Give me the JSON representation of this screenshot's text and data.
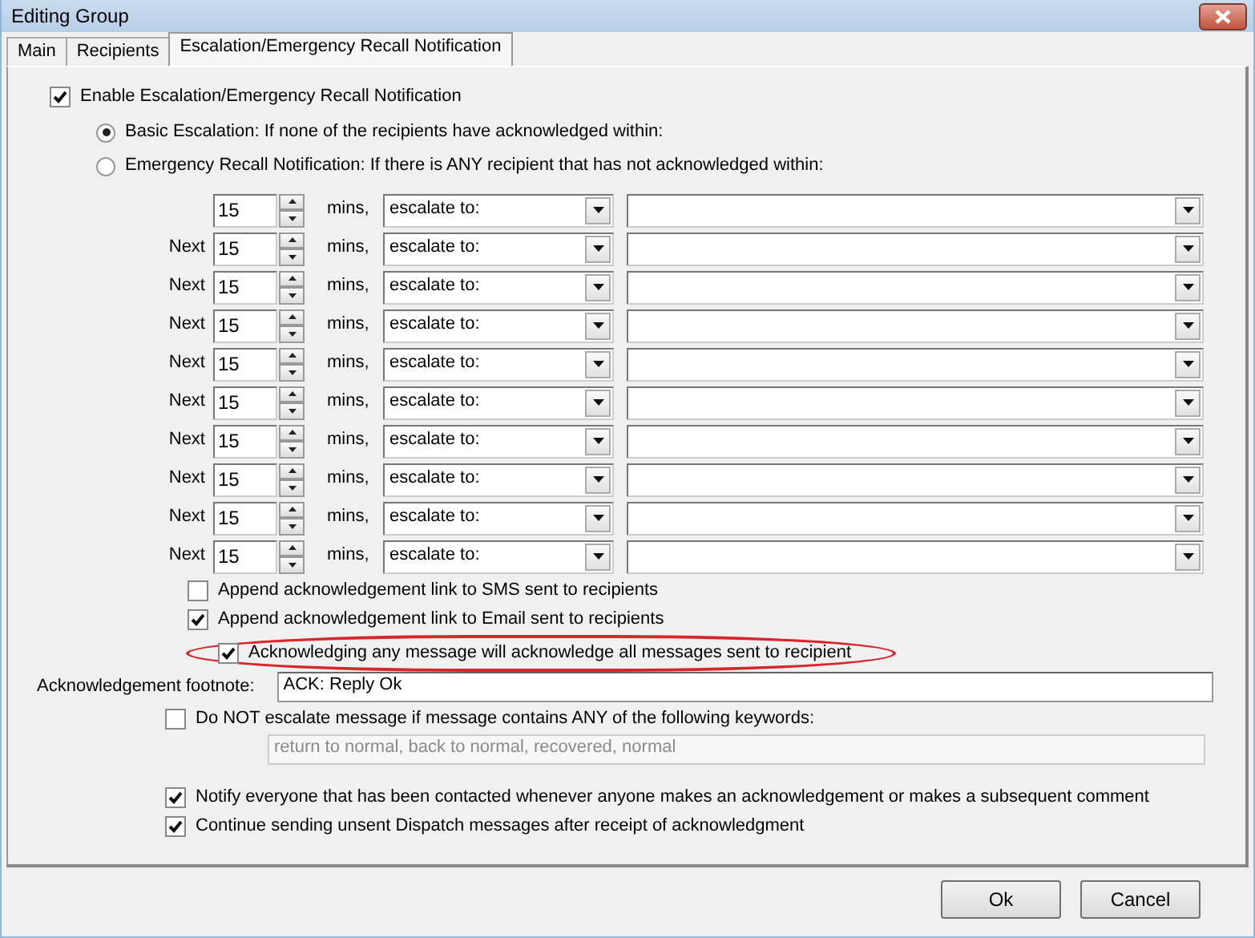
{
  "window": {
    "title": "Editing Group"
  },
  "tabs": [
    {
      "label": "Main",
      "selected": false
    },
    {
      "label": "Recipients",
      "selected": false
    },
    {
      "label": "Escalation/Emergency Recall Notification",
      "selected": true
    }
  ],
  "enable": {
    "label": "Enable Escalation/Emergency Recall Notification",
    "checked": true
  },
  "modes": [
    {
      "label": "Basic Escalation: If none of the recipients have acknowledged within:",
      "selected": true
    },
    {
      "label": "Emergency Recall Notification: If there is ANY recipient that has not acknowledged within:",
      "selected": false
    }
  ],
  "escalation_rows": [
    {
      "minutes": "15",
      "unit": "mins,",
      "action": "escalate to:"
    },
    {
      "prefix": "Next",
      "minutes": "15",
      "unit": "mins,",
      "action": "escalate to:"
    },
    {
      "prefix": "Next",
      "minutes": "15",
      "unit": "mins,",
      "action": "escalate to:"
    },
    {
      "prefix": "Next",
      "minutes": "15",
      "unit": "mins,",
      "action": "escalate to:"
    },
    {
      "prefix": "Next",
      "minutes": "15",
      "unit": "mins,",
      "action": "escalate to:"
    },
    {
      "prefix": "Next",
      "minutes": "15",
      "unit": "mins,",
      "action": "escalate to:"
    },
    {
      "prefix": "Next",
      "minutes": "15",
      "unit": "mins,",
      "action": "escalate to:"
    },
    {
      "prefix": "Next",
      "minutes": "15",
      "unit": "mins,",
      "action": "escalate to:"
    },
    {
      "prefix": "Next",
      "minutes": "15",
      "unit": "mins,",
      "action": "escalate to:"
    },
    {
      "prefix": "Next",
      "minutes": "15",
      "unit": "mins,",
      "action": "escalate to:"
    }
  ],
  "ack_options": [
    {
      "label": "Append acknowledgement link to SMS sent to recipients",
      "checked": false,
      "circled": false
    },
    {
      "label": "Append acknowledgement link to Email sent to recipients",
      "checked": true,
      "circled": false
    },
    {
      "label": "Acknowledging any message will acknowledge all messages sent to recipient",
      "checked": true,
      "circled": true
    }
  ],
  "footnote": {
    "label": "Acknowledgement footnote:",
    "value": "ACK: Reply Ok"
  },
  "keyword_filter": {
    "label": "Do NOT escalate message if message contains ANY of the following keywords:",
    "checked": false,
    "value": "return to normal, back to normal, recovered, normal",
    "disabled": true
  },
  "notify_options": [
    {
      "label": "Notify everyone that has been contacted whenever anyone makes an acknowledgement or makes a subsequent comment",
      "checked": true
    },
    {
      "label": "Continue sending unsent Dispatch messages after receipt of acknowledgment",
      "checked": true
    }
  ],
  "buttons": [
    {
      "label": "Ok"
    },
    {
      "label": "Cancel"
    }
  ]
}
